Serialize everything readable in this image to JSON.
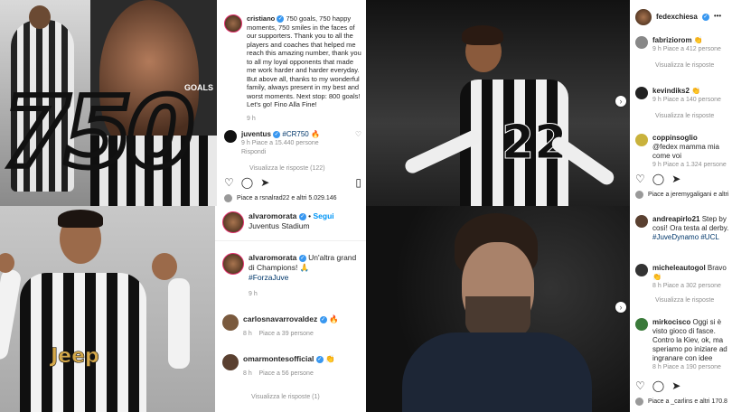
{
  "q1": {
    "photo_text_big": "750",
    "photo_text_small": "GOALS",
    "caption": {
      "user": "cristiano",
      "text": "750 goals, 750 happy moments, 750 smiles in the faces of our supporters. Thank you to all the players and coaches that helped me reach this amazing number, thank you to all my loyal opponents that made me work harder and harder everyday. But above all, thanks to my wonderful family, always present in my best and worst moments. Next stop: 800 goals! Let's go! Fino Alla Fine!",
      "time": "9 h"
    },
    "comment": {
      "user": "juventus",
      "text": "#CR750",
      "time": "9 h",
      "likes": "Piace a 15.440 persone",
      "reply": "Rispondi"
    },
    "view_replies": "Visualizza le risposte (122)",
    "liked_by": "Piace a rsnalrad22 e altri 5.029.146"
  },
  "q2": {
    "comments": [
      {
        "user": "fedexchiesa",
        "text": "",
        "time": "",
        "likes": ""
      },
      {
        "user": "fabriziorom",
        "text": "",
        "time": "9 h",
        "likes": "Piace a 412 persone"
      },
      {
        "user": "kevindiks2",
        "text": "",
        "time": "9 h",
        "likes": "Piace a 140 persone"
      },
      {
        "user": "coppinsoglio",
        "text": "@fedex mamma mia come voi",
        "time": "9 h",
        "likes": "Piace a 1.324 persone"
      }
    ],
    "view_replies": "Visualizza le risposte",
    "liked_by": "Piace a jeremygaligani e altri"
  },
  "q3": {
    "jersey_brand": "Jeep",
    "header": {
      "user": "alvaromorata",
      "follow": "Segui",
      "location": "Juventus Stadium"
    },
    "caption": {
      "user": "alvaromorata",
      "text": "Un'altra grand di Champions!",
      "hashtag": "#ForzaJuve",
      "time": "9 h"
    },
    "comments": [
      {
        "user": "carlosnavarrovaldez",
        "time": "8 h",
        "likes": "Piace a 39 persone"
      },
      {
        "user": "omarmontesofficial",
        "time": "8 h",
        "likes": "Piace a 56 persone"
      }
    ],
    "view_replies": "Visualizza le risposte (1)"
  },
  "q4": {
    "caption": {
      "user": "andreapirlo21",
      "text": "Step by così! Ora testa al derby.",
      "hashtags": "#JuveDynamo #UCL"
    },
    "comments": [
      {
        "user": "micheleautogol",
        "text": "Bravo",
        "time": "8 h",
        "likes": "Piace a 302 persone"
      },
      {
        "user": "mirkocisco",
        "text": "Oggi si è visto gioco di fasce. Contro la Kiev, ok, ma speriamo po iniziare ad ingranare con idee",
        "time": "8 h",
        "likes": "Piace a 190 persone"
      }
    ],
    "view_replies": "Visualizza le risposte",
    "liked_by": "Piace a _carlins e altri 170.8"
  }
}
